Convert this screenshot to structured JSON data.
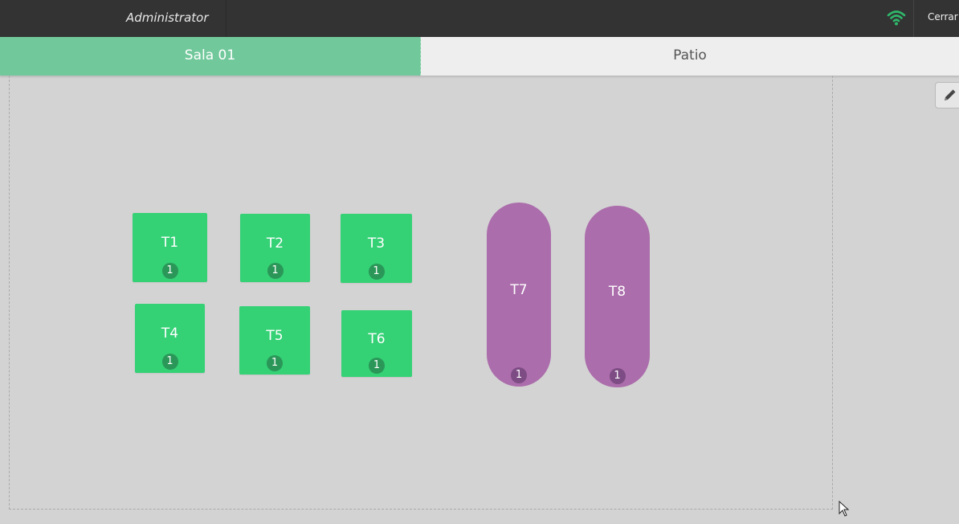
{
  "header": {
    "username": "Administrator",
    "logout_label": "Cerrar",
    "wifi_icon": "wifi-icon",
    "wifi_color": "#2fb86a"
  },
  "tabs": [
    {
      "label": "Sala 01",
      "active": true
    },
    {
      "label": "Patio",
      "active": false
    }
  ],
  "colors": {
    "available_table": "#34d175",
    "pill_table": "#ab6dab",
    "active_tab": "#71c89b"
  },
  "edit_icon": "pencil-icon",
  "tables": [
    {
      "id": "T1",
      "shape": "square",
      "seats": "1"
    },
    {
      "id": "T2",
      "shape": "square",
      "seats": "1"
    },
    {
      "id": "T3",
      "shape": "square",
      "seats": "1"
    },
    {
      "id": "T4",
      "shape": "square",
      "seats": "1"
    },
    {
      "id": "T5",
      "shape": "square",
      "seats": "1"
    },
    {
      "id": "T6",
      "shape": "square",
      "seats": "1"
    },
    {
      "id": "T7",
      "shape": "pill",
      "seats": "1"
    },
    {
      "id": "T8",
      "shape": "pill",
      "seats": "1"
    }
  ]
}
